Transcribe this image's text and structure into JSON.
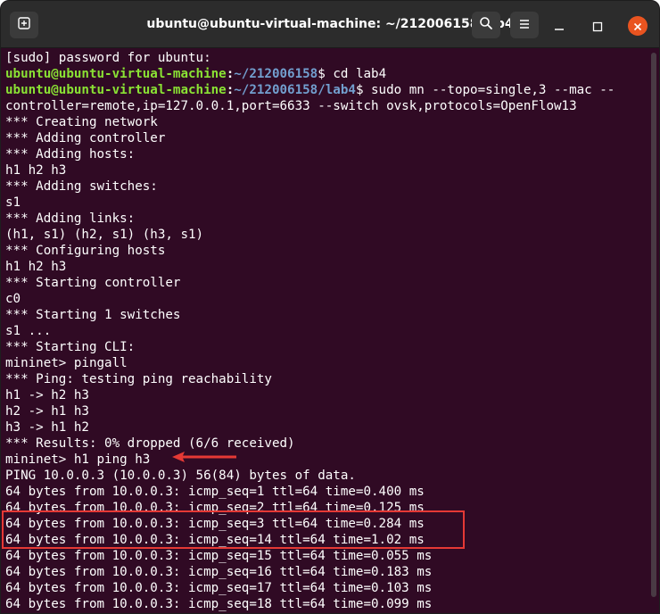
{
  "window": {
    "title": "ubuntu@ubuntu-virtual-machine: ~/212006158/lab4"
  },
  "icons": {
    "new_tab": "new-tab-icon",
    "search": "search-icon",
    "menu": "hamburger-menu-icon",
    "minimize": "minimize-icon",
    "maximize": "maximize-icon",
    "close": "close-icon",
    "annotation_arrow": "red-arrow-icon"
  },
  "colors": {
    "terminal_bg": "#300a24",
    "prompt_user": "#8ae234",
    "prompt_path": "#729fcf",
    "annotation": "#e53935",
    "close_button": "#e95420"
  },
  "terminal": {
    "lines": [
      "[sudo] password for ubuntu:",
      {
        "user": "ubuntu@ubuntu-virtual-machine",
        "path": "~/212006158",
        "cmd": "$ cd lab4"
      },
      {
        "user": "ubuntu@ubuntu-virtual-machine",
        "path": "~/212006158/lab4",
        "cmd": "$ sudo mn --topo=single,3 --mac --"
      },
      "controller=remote,ip=127.0.0.1,port=6633 --switch ovsk,protocols=OpenFlow13",
      "*** Creating network",
      "*** Adding controller",
      "*** Adding hosts:",
      "h1 h2 h3",
      "*** Adding switches:",
      "s1",
      "*** Adding links:",
      "(h1, s1) (h2, s1) (h3, s1)",
      "*** Configuring hosts",
      "h1 h2 h3",
      "*** Starting controller",
      "c0",
      "*** Starting 1 switches",
      "s1 ...",
      "*** Starting CLI:",
      "mininet> pingall",
      "*** Ping: testing ping reachability",
      "h1 -> h2 h3",
      "h2 -> h1 h3",
      "h3 -> h1 h2",
      "*** Results: 0% dropped (6/6 received)",
      "mininet> h1 ping h3",
      "PING 10.0.0.3 (10.0.0.3) 56(84) bytes of data.",
      "64 bytes from 10.0.0.3: icmp_seq=1 ttl=64 time=0.400 ms",
      "64 bytes from 10.0.0.3: icmp_seq=2 ttl=64 time=0.125 ms",
      "64 bytes from 10.0.0.3: icmp_seq=3 ttl=64 time=0.284 ms",
      "64 bytes from 10.0.0.3: icmp_seq=14 ttl=64 time=1.02 ms",
      "64 bytes from 10.0.0.3: icmp_seq=15 ttl=64 time=0.055 ms",
      "64 bytes from 10.0.0.3: icmp_seq=16 ttl=64 time=0.183 ms",
      "64 bytes from 10.0.0.3: icmp_seq=17 ttl=64 time=0.103 ms",
      "64 bytes from 10.0.0.3: icmp_seq=18 ttl=64 time=0.099 ms"
    ]
  }
}
